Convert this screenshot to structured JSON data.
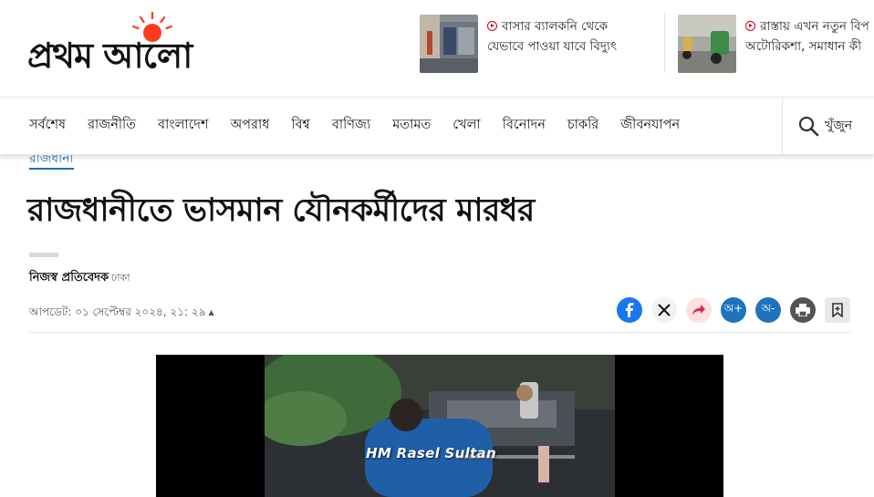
{
  "site": {
    "logo_text": "প্রথম আলো",
    "accent": "#d0021b",
    "sun_color": "#ff3b1f"
  },
  "promos": [
    {
      "title_line1": "বাসার ব্যালকনি থেকে",
      "title_line2": "যেভাবে পাওয়া যাবে বিদ্যুৎ"
    },
    {
      "title_line1": "রাস্তায় এখন নতুন বিপ",
      "title_line2": "অটোরিকশা, সমাধান কী"
    }
  ],
  "nav": {
    "items": [
      "সর্বশেষ",
      "রাজনীতি",
      "বাংলাদেশ",
      "অপরাধ",
      "বিশ্ব",
      "বাণিজ্য",
      "মতামত",
      "খেলা",
      "বিনোদন",
      "চাকরি",
      "জীবনযাপন"
    ],
    "search_label": "খুঁজুন"
  },
  "article": {
    "section": "রাজধানী",
    "headline": "রাজধানীতে ভাসমান যৌনকর্মীদের মারধর",
    "author": "নিজস্ব প্রতিবেদক",
    "location": "ঢাকা",
    "updated": "আপডেট: ০১ সেপ্টেম্বর ২০২৪, ২১: ২৯"
  },
  "share": {
    "facebook_color": "#1877f2",
    "x_color": "#111111",
    "share_color": "#fde0e0",
    "font_bigger_label": "অ+",
    "font_smaller_label": "অ-",
    "font_button_color": "#1e73be",
    "print_color": "#555555",
    "bookmark_color": "#e8e8e8"
  },
  "video": {
    "watermark": "HM Rasel Sultan"
  }
}
